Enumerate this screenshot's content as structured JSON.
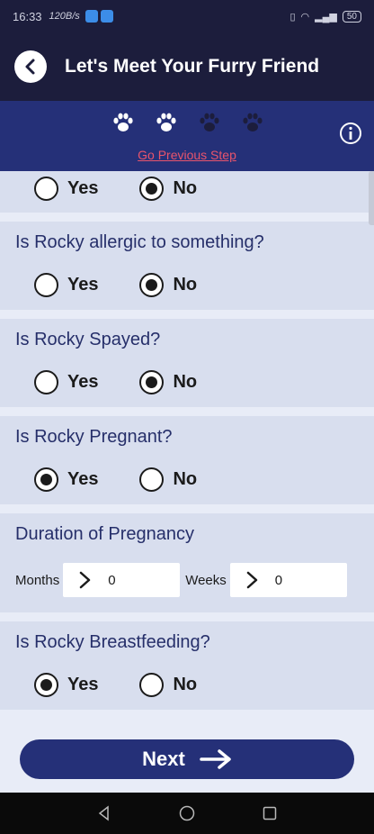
{
  "status": {
    "time": "16:33",
    "speed": "120B/s",
    "battery": "50"
  },
  "header": {
    "title": "Let's Meet Your Furry Friend"
  },
  "steps": {
    "prev_label": "Go Previous Step",
    "total": 4,
    "completed": 2
  },
  "questions": [
    {
      "label": "",
      "yes": "Yes",
      "no": "No",
      "selected": "no"
    },
    {
      "label": "Is Rocky allergic to something?",
      "yes": "Yes",
      "no": "No",
      "selected": "no"
    },
    {
      "label": "Is Rocky Spayed?",
      "yes": "Yes",
      "no": "No",
      "selected": "no"
    },
    {
      "label": "Is Rocky Pregnant?",
      "yes": "Yes",
      "no": "No",
      "selected": "yes"
    },
    {
      "label": "Is Rocky Breastfeeding?",
      "yes": "Yes",
      "no": "No",
      "selected": "yes"
    }
  ],
  "duration": {
    "label": "Duration of Pregnancy",
    "months_label": "Months",
    "months_value": "0",
    "weeks_label": "Weeks",
    "weeks_value": "0"
  },
  "next": {
    "label": "Next"
  },
  "colors": {
    "header": "#1c1d3c",
    "accent": "#253078",
    "link": "#e8546c",
    "section": "#d8deee"
  }
}
